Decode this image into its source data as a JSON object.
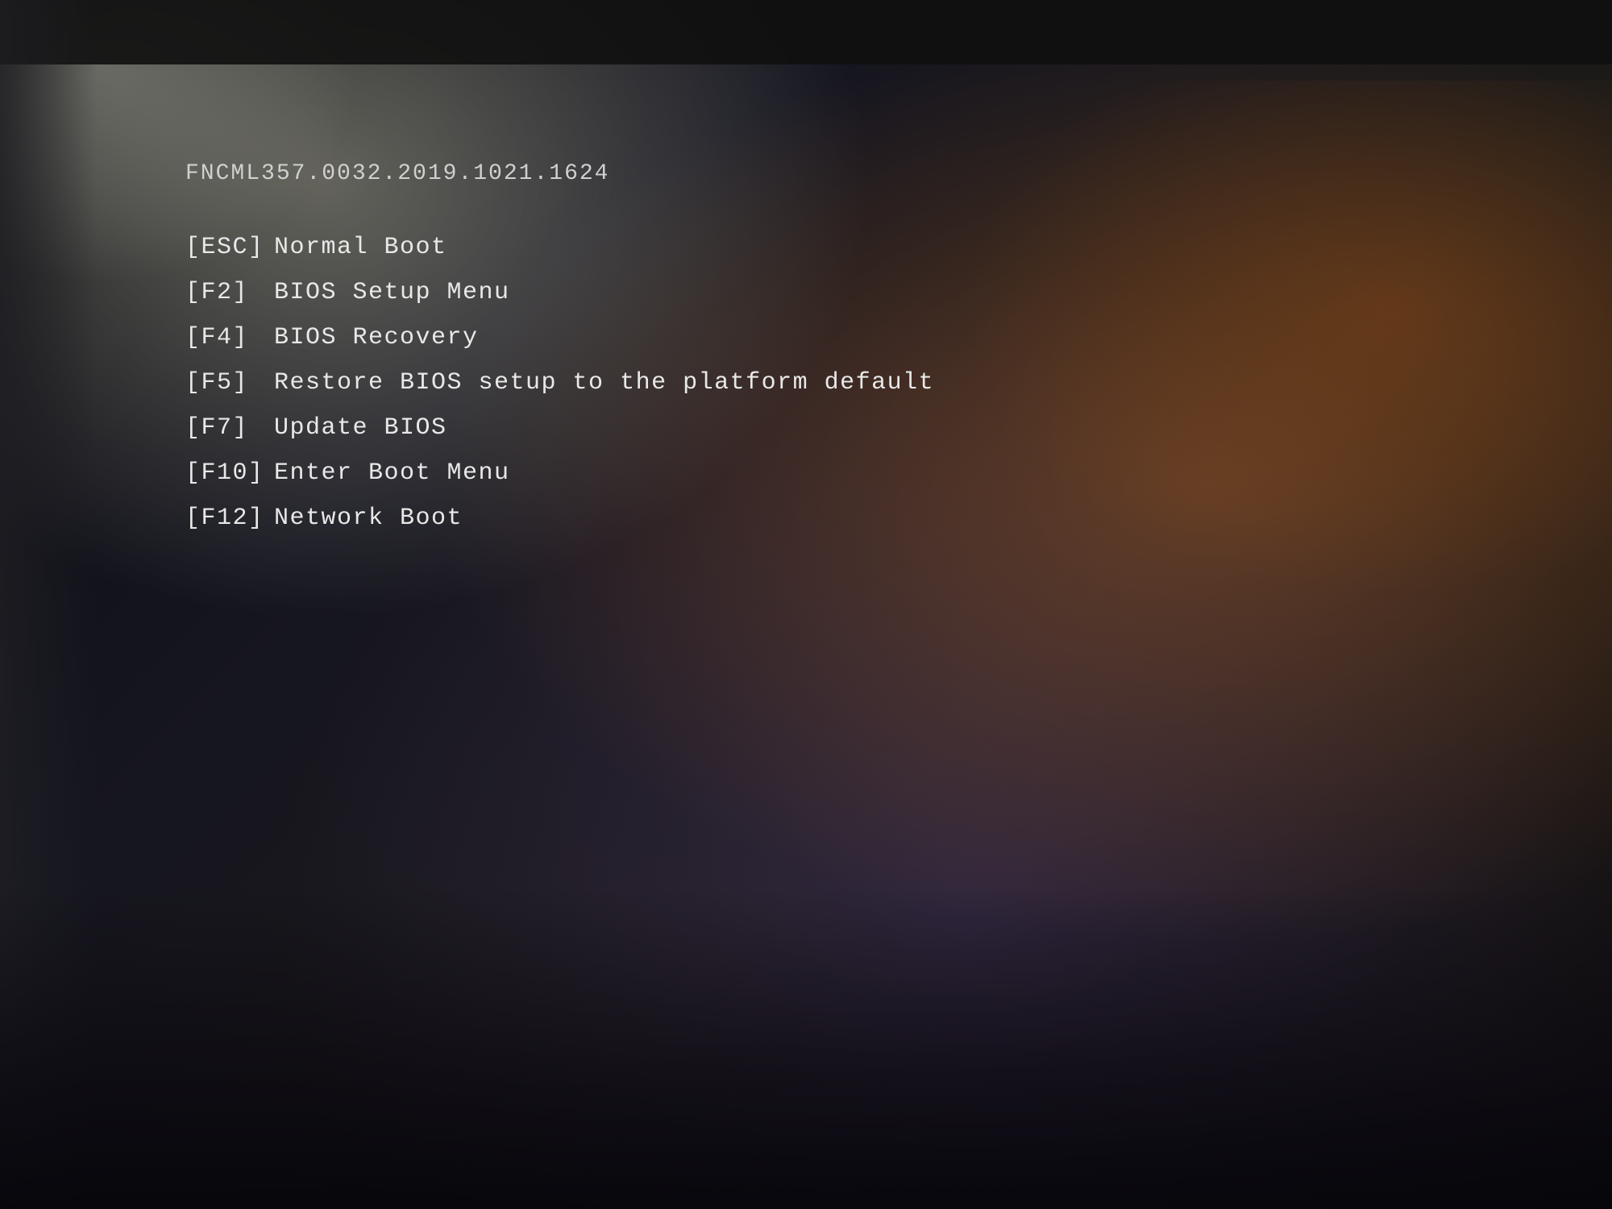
{
  "screen": {
    "firmware_version": "FNCML357.0032.2019.1021.1624",
    "menu_items": [
      {
        "key": "[ESC]",
        "description": "Normal Boot"
      },
      {
        "key": "[F2]",
        "description": "BIOS Setup Menu"
      },
      {
        "key": "[F4]",
        "description": "BIOS Recovery"
      },
      {
        "key": "[F5]",
        "description": "Restore BIOS setup to the platform default"
      },
      {
        "key": "[F7]",
        "description": "Update BIOS"
      },
      {
        "key": "[F10]",
        "description": "Enter Boot Menu"
      },
      {
        "key": "[F12]",
        "description": "Network Boot"
      }
    ]
  }
}
